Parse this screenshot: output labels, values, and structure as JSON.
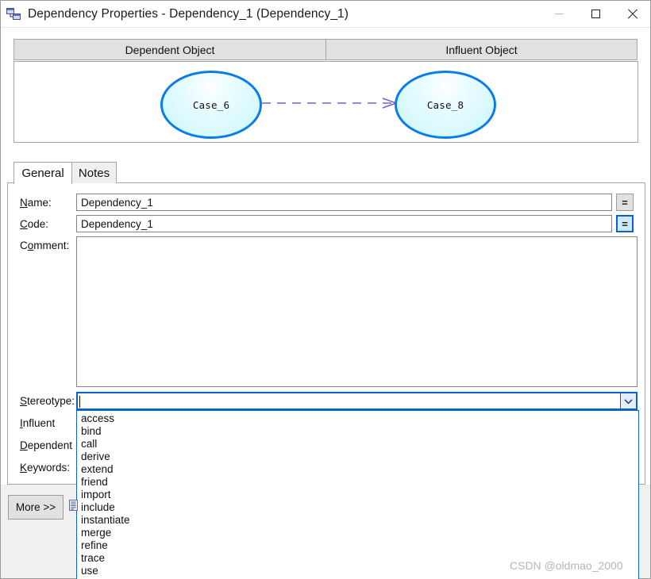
{
  "window": {
    "title": "Dependency Properties - Dependency_1 (Dependency_1)",
    "icon": "dependency-icon",
    "minimize_label": "Minimize",
    "maximize_label": "Maximize",
    "close_label": "Close"
  },
  "object_panels": {
    "dependent_header": "Dependent Object",
    "influent_header": "Influent Object"
  },
  "diagram": {
    "dependent_node": "Case_6",
    "influent_node": "Case_8",
    "node_border_color": "#0a7ce8",
    "node_fill_color": "#c9f6fb",
    "arrow_color": "#6666cc",
    "arrow_style": "dashed"
  },
  "tabs": [
    {
      "label": "General",
      "active": true
    },
    {
      "label": "Notes",
      "active": false
    }
  ],
  "form": {
    "name": {
      "label_prefix": "",
      "label_accesskey": "N",
      "label_suffix": "ame:",
      "value": "Dependency_1",
      "button_label": "="
    },
    "code": {
      "label_prefix": "",
      "label_accesskey": "C",
      "label_suffix": "ode:",
      "value": "Dependency_1",
      "button_label": "="
    },
    "comment": {
      "label_prefix": "C",
      "label_accesskey": "o",
      "label_suffix": "mment:",
      "value": ""
    },
    "stereotype": {
      "label_prefix": "",
      "label_accesskey": "S",
      "label_suffix": "tereotype:",
      "value": "",
      "expanded": true,
      "dropdown_icon": "chevron-down-icon"
    },
    "influent": {
      "label_prefix": "",
      "label_accesskey": "I",
      "label_suffix": "nfluent",
      "value": ""
    },
    "dependent": {
      "label_prefix": "",
      "label_accesskey": "D",
      "label_suffix": "ependent",
      "value": ""
    },
    "keywords": {
      "label_prefix": "",
      "label_accesskey": "K",
      "label_suffix": "eywords:",
      "value": ""
    }
  },
  "stereotype_options": [
    "access",
    "bind",
    "call",
    "derive",
    "extend",
    "friend",
    "import",
    "include",
    "instantiate",
    "merge",
    "refine",
    "trace",
    "use"
  ],
  "footer": {
    "more_button": "More >>",
    "list_icon": "list-icon"
  },
  "watermark": "CSDN @oldmao_2000",
  "colors": {
    "accent": "#0a64c8",
    "node_border": "#0a7ce8",
    "dialog_bg": "#f0f0f0"
  }
}
